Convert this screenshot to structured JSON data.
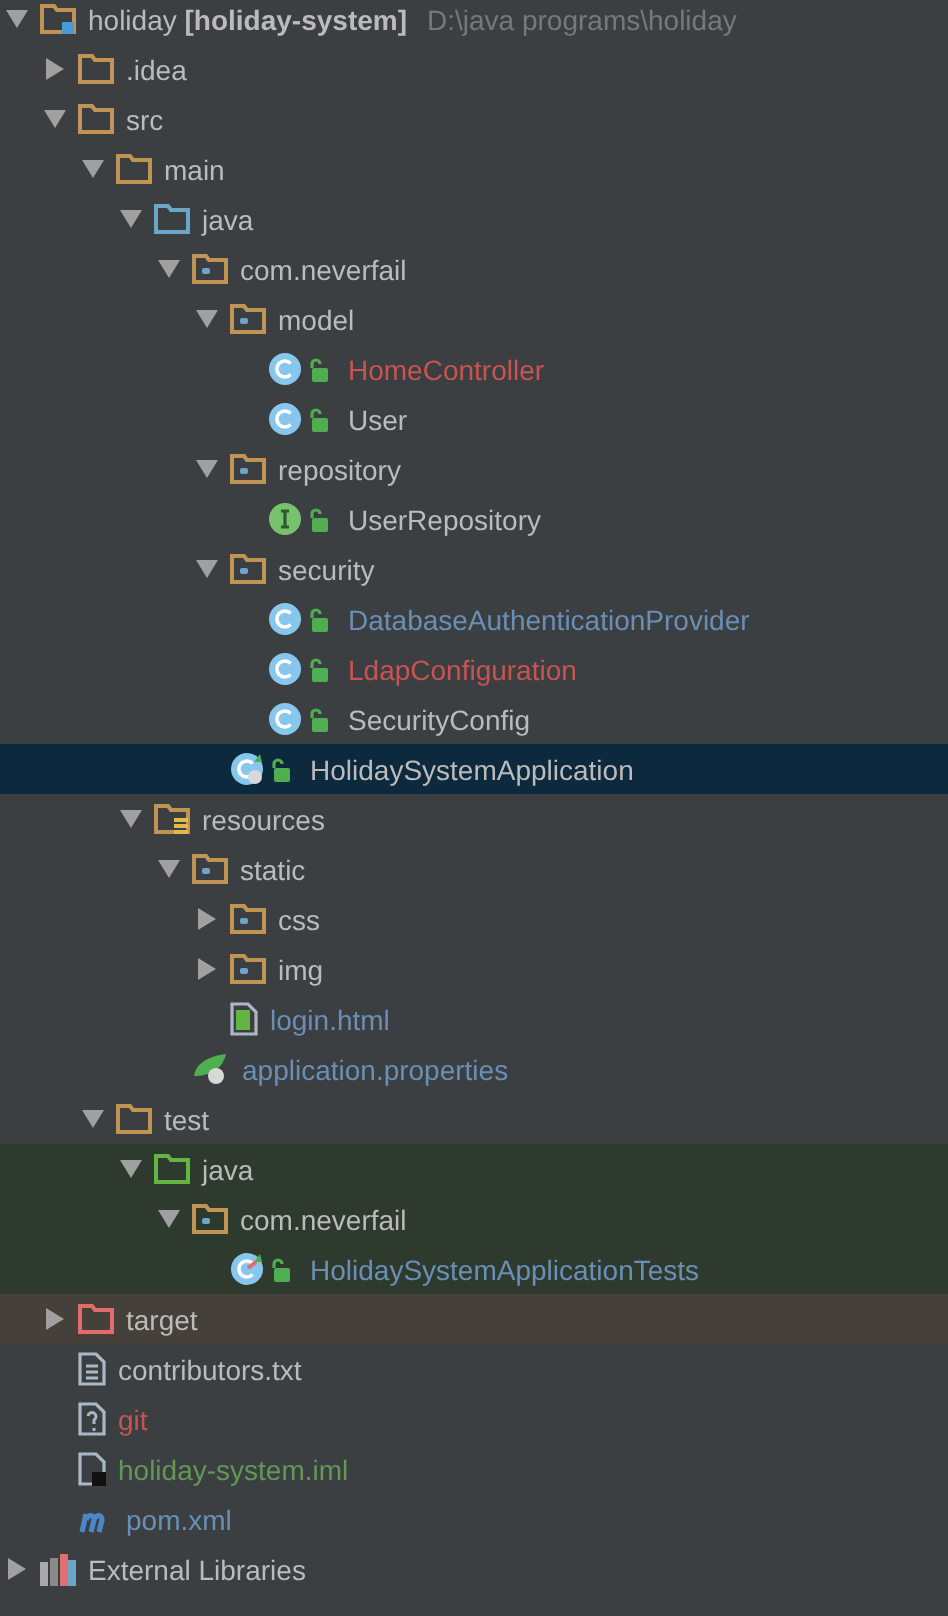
{
  "tree": [
    {
      "kind": "module",
      "name": "holiday **[holiday-system]**",
      "path": "D:\\java programs\\holiday",
      "expanded": true,
      "selected": false,
      "color": "#bbbbbb",
      "children": [
        {
          "kind": "folder",
          "name": ".idea",
          "expanded": false,
          "selected": false,
          "color": "#bbbbbb"
        },
        {
          "kind": "folder",
          "name": "src",
          "expanded": true,
          "selected": false,
          "color": "#bbbbbb",
          "children": [
            {
              "kind": "folder",
              "name": "main",
              "expanded": true,
              "selected": false,
              "color": "#bbbbbb",
              "children": [
                {
                  "kind": "source-root",
                  "name": "java",
                  "expanded": true,
                  "selected": false,
                  "color": "#bbbbbb",
                  "children": [
                    {
                      "kind": "package",
                      "name": "com.neverfail",
                      "expanded": true,
                      "selected": false,
                      "color": "#bbbbbb",
                      "children": [
                        {
                          "kind": "package",
                          "name": "model",
                          "expanded": true,
                          "selected": false,
                          "color": "#bbbbbb",
                          "children": [
                            {
                              "kind": "class",
                              "name": "HomeController",
                              "selected": false,
                              "color": "#c75450"
                            },
                            {
                              "kind": "class",
                              "name": "User",
                              "selected": false,
                              "color": "#bbbbbb"
                            }
                          ]
                        },
                        {
                          "kind": "package",
                          "name": "repository",
                          "expanded": true,
                          "selected": false,
                          "color": "#bbbbbb",
                          "children": [
                            {
                              "kind": "interface",
                              "name": "UserRepository",
                              "selected": false,
                              "color": "#bbbbbb"
                            }
                          ]
                        },
                        {
                          "kind": "package",
                          "name": "security",
                          "expanded": true,
                          "selected": false,
                          "color": "#bbbbbb",
                          "children": [
                            {
                              "kind": "class",
                              "name": "DatabaseAuthenticationProvider",
                              "selected": false,
                              "color": "#6a8fb5"
                            },
                            {
                              "kind": "class",
                              "name": "LdapConfiguration",
                              "selected": false,
                              "color": "#c75450"
                            },
                            {
                              "kind": "class",
                              "name": "SecurityConfig",
                              "selected": false,
                              "color": "#bbbbbb"
                            }
                          ]
                        },
                        {
                          "kind": "app-class",
                          "name": "HolidaySystemApplication",
                          "selected": true,
                          "color": "#bbbbbb"
                        }
                      ]
                    }
                  ]
                },
                {
                  "kind": "resources-root",
                  "name": "resources",
                  "expanded": true,
                  "selected": false,
                  "color": "#bbbbbb",
                  "children": [
                    {
                      "kind": "package",
                      "name": "static",
                      "expanded": true,
                      "selected": false,
                      "color": "#bbbbbb",
                      "children": [
                        {
                          "kind": "package",
                          "name": "css",
                          "expanded": false,
                          "selected": false,
                          "color": "#bbbbbb"
                        },
                        {
                          "kind": "package",
                          "name": "img",
                          "expanded": false,
                          "selected": false,
                          "color": "#bbbbbb"
                        },
                        {
                          "kind": "html",
                          "name": "login.html",
                          "selected": false,
                          "color": "#6a8fb5"
                        }
                      ]
                    },
                    {
                      "kind": "properties",
                      "name": "application.properties",
                      "selected": false,
                      "color": "#6a8fb5"
                    }
                  ]
                }
              ]
            },
            {
              "kind": "folder",
              "name": "test",
              "expanded": true,
              "selected": false,
              "color": "#bbbbbb",
              "children": [
                {
                  "kind": "test-root",
                  "name": "java",
                  "expanded": true,
                  "selected": false,
                  "color": "#bbbbbb",
                  "test_scope": true,
                  "children": [
                    {
                      "kind": "package",
                      "name": "com.neverfail",
                      "expanded": true,
                      "selected": false,
                      "color": "#bbbbbb",
                      "children": [
                        {
                          "kind": "test-class",
                          "name": "HolidaySystemApplicationTests",
                          "selected": false,
                          "color": "#6a8fb5"
                        }
                      ]
                    }
                  ]
                }
              ]
            }
          ]
        },
        {
          "kind": "excluded-folder",
          "name": "target",
          "expanded": false,
          "selected": false,
          "color": "#bbbbbb",
          "excluded": true
        },
        {
          "kind": "text",
          "name": "contributors.txt",
          "selected": false,
          "color": "#bbbbbb"
        },
        {
          "kind": "unknown",
          "name": "git",
          "selected": false,
          "color": "#c75450"
        },
        {
          "kind": "iml",
          "name": "holiday-system.iml",
          "selected": false,
          "color": "#629755"
        },
        {
          "kind": "maven",
          "name": "pom.xml",
          "selected": false,
          "color": "#6a8fb5"
        }
      ]
    },
    {
      "kind": "libraries",
      "name": "External Libraries",
      "expanded": false,
      "selected": false,
      "color": "#bbbbbb"
    }
  ]
}
